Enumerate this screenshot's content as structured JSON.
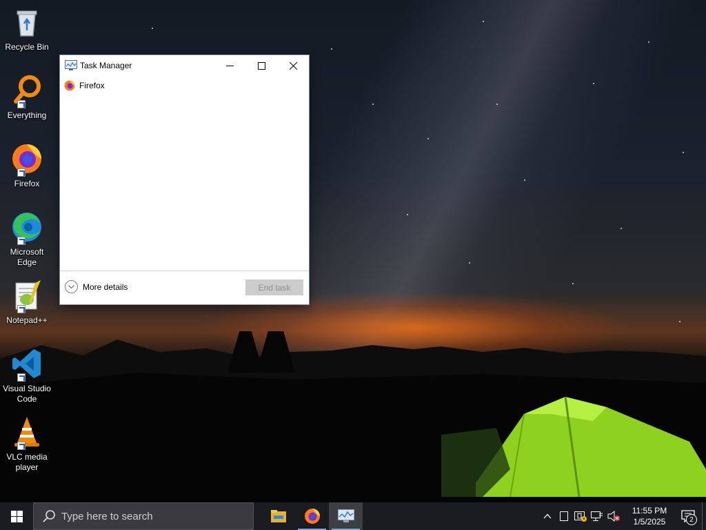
{
  "desktop": {
    "icons": [
      {
        "label": "Recycle Bin",
        "icon": "recycle-bin-icon"
      },
      {
        "label": "Everything",
        "icon": "everything-search-icon"
      },
      {
        "label": "Firefox",
        "icon": "firefox-icon"
      },
      {
        "label": "Microsoft Edge",
        "icon": "edge-icon"
      },
      {
        "label": "Notepad++",
        "icon": "notepadpp-icon"
      },
      {
        "label": "Visual Studio Code",
        "icon": "vscode-icon"
      },
      {
        "label": "VLC media player",
        "icon": "vlc-icon"
      }
    ]
  },
  "task_manager": {
    "title": "Task Manager",
    "processes": [
      {
        "name": "Firefox",
        "icon": "firefox-icon"
      }
    ],
    "more_details_label": "More details",
    "end_task_label": "End task"
  },
  "taskbar": {
    "search_placeholder": "Type here to search",
    "pinned": [
      {
        "name": "File Explorer",
        "icon": "file-explorer-icon"
      },
      {
        "name": "Firefox",
        "icon": "firefox-icon"
      },
      {
        "name": "Task Manager",
        "icon": "task-manager-icon"
      }
    ],
    "clock": {
      "time": "11:55 PM",
      "date": "1/5/2025"
    },
    "notification_count": "2"
  },
  "colors": {
    "taskbar_bg": "#1b1c22",
    "search_bg": "#3b3b3f",
    "accent_underline": "#7aa6da",
    "end_task_disabled_bg": "#cccccc"
  }
}
